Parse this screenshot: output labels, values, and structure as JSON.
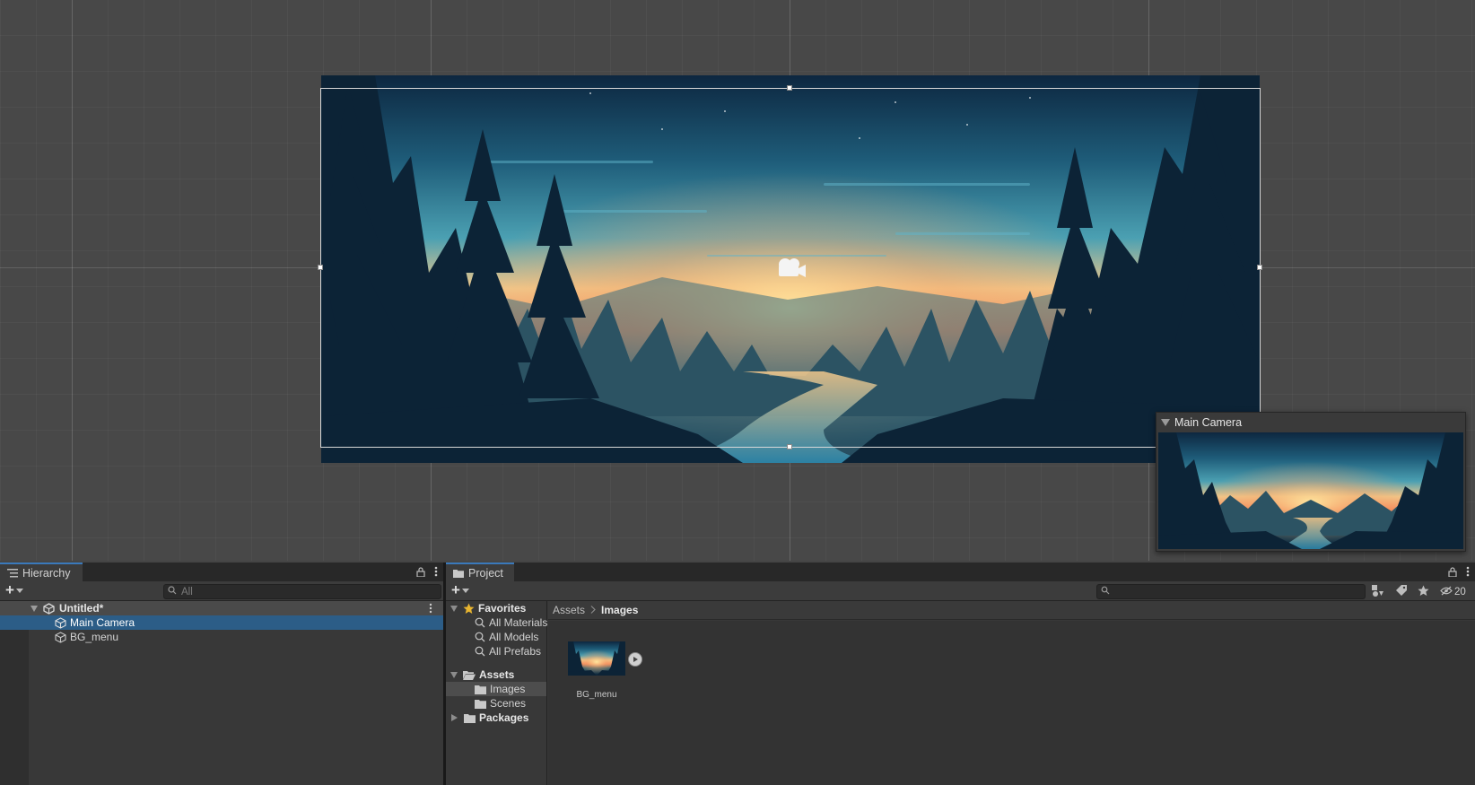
{
  "scene": {
    "sprite_name": "BG_menu",
    "camera_gizmo": "camera-icon"
  },
  "camera_preview": {
    "title": "Main Camera"
  },
  "hierarchy": {
    "tab_label": "Hierarchy",
    "search_placeholder": "All",
    "scene_name": "Untitled*",
    "items": [
      {
        "label": "Main Camera",
        "selected": true,
        "icon": "gameobject-cube-icon"
      },
      {
        "label": "BG_menu",
        "selected": false,
        "icon": "gameobject-cube-icon"
      }
    ]
  },
  "project": {
    "tab_label": "Project",
    "search_placeholder": "",
    "hidden_count": "20",
    "favorites": {
      "label": "Favorites",
      "items": [
        "All Materials",
        "All Models",
        "All Prefabs"
      ]
    },
    "assets": {
      "label": "Assets",
      "folders": [
        "Images",
        "Scenes"
      ],
      "selected_folder": "Images"
    },
    "packages_label": "Packages",
    "breadcrumb": [
      "Assets",
      "Images"
    ],
    "files": [
      {
        "name": "BG_menu",
        "type": "sprite"
      }
    ]
  },
  "colors": {
    "selection": "#2c5d87",
    "tab_accent": "#3a79bb",
    "favorites_star": "#e8b530",
    "panel_bg": "#383838",
    "scene_bg": "#484848"
  }
}
